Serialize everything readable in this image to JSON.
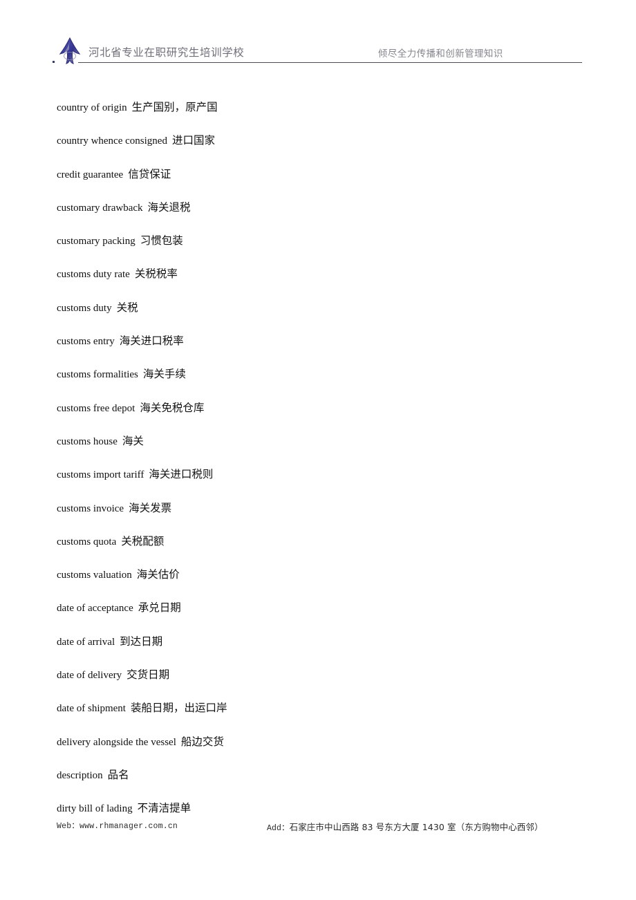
{
  "header": {
    "logo_icon": "person-glyph-logo",
    "title_left": "河北省专业在职研究生培训学校",
    "title_right": "倾尽全力传播和创新管理知识",
    "rule_color": "#4a4a52",
    "logo_color": "#3b3b9b"
  },
  "glossary": {
    "entries": [
      {
        "term": "country of origin",
        "gloss": "生产国别，原产国"
      },
      {
        "term": "country whence consigned",
        "gloss": "进口国家"
      },
      {
        "term": "credit guarantee",
        "gloss": "信贷保证"
      },
      {
        "term": "customary drawback",
        "gloss": "海关退税"
      },
      {
        "term": "customary packing",
        "gloss": "习惯包装"
      },
      {
        "term": "customs duty rate",
        "gloss": "关税税率"
      },
      {
        "term": "customs duty",
        "gloss": "关税"
      },
      {
        "term": "customs entry",
        "gloss": "海关进口税率"
      },
      {
        "term": "customs formalities",
        "gloss": "海关手续"
      },
      {
        "term": "customs free depot",
        "gloss": "海关免税仓库"
      },
      {
        "term": "customs house",
        "gloss": "海关"
      },
      {
        "term": "customs import tariff",
        "gloss": "海关进口税则"
      },
      {
        "term": "customs invoice",
        "gloss": "海关发票"
      },
      {
        "term": "customs quota",
        "gloss": "关税配额"
      },
      {
        "term": "customs valuation",
        "gloss": "海关估价"
      },
      {
        "term": "date of acceptance",
        "gloss": "承兑日期"
      },
      {
        "term": "date of arrival",
        "gloss": "到达日期"
      },
      {
        "term": "date of delivery",
        "gloss": "交货日期"
      },
      {
        "term": "date of shipment",
        "gloss": "装船日期，出运口岸"
      },
      {
        "term": "delivery alongside the vessel",
        "gloss": "船边交货"
      },
      {
        "term": "description",
        "gloss": "品名"
      },
      {
        "term": "dirty bill of lading",
        "gloss": "不清洁提单"
      }
    ]
  },
  "footer": {
    "web": "Web：www.rhmanager.com.cn",
    "address_label": "Add：",
    "address_value": "石家庄市中山西路 83 号东方大厦 1430 室（东方购物中心西邻）"
  }
}
